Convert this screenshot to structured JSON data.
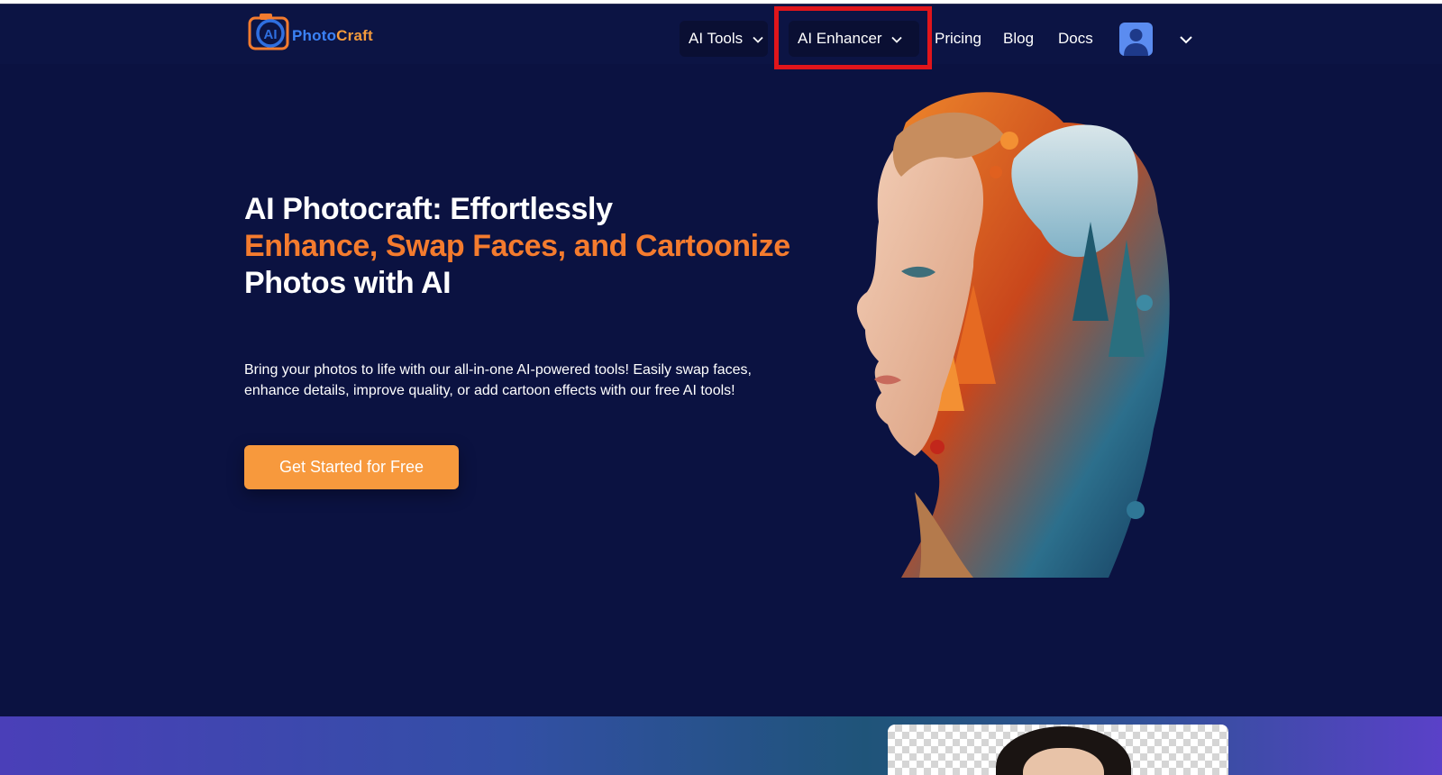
{
  "brand": {
    "logo_badge": "AI",
    "name_part1": "Photo",
    "name_part2": "Craft"
  },
  "nav": {
    "items": [
      {
        "label": "AI Tools",
        "has_dropdown": true
      },
      {
        "label": "AI Enhancer",
        "has_dropdown": true,
        "highlighted": true
      },
      {
        "label": "Pricing"
      },
      {
        "label": "Blog"
      },
      {
        "label": "Docs"
      }
    ],
    "account_icon": "user-avatar-icon",
    "account_menu_icon": "chevron-down-icon"
  },
  "hero": {
    "title_line1": "AI Photocraft: Effortlessly",
    "title_line2": "Enhance, Swap Faces, and Cartoonize",
    "title_line3": "Photos with AI",
    "description": "Bring your photos to life with our all-in-one AI-powered tools! Easily swap faces, enhance details, improve quality, or add cartoon effects with our free AI tools!",
    "cta_label": "Get Started for Free"
  },
  "colors": {
    "background": "#0b1241",
    "accent_orange": "#f47b2e",
    "button_orange": "#f7993d",
    "highlight_red": "#e0151b"
  }
}
